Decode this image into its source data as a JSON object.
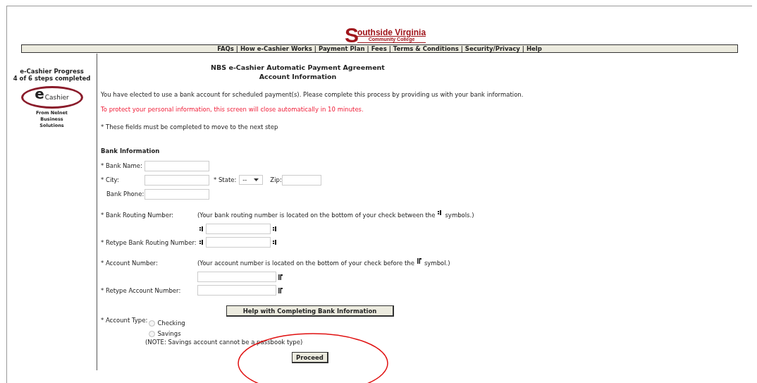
{
  "logo": {
    "initial": "S",
    "name": "outhside Virginia",
    "subtitle": "Community College"
  },
  "nav": {
    "separator": "|",
    "links": [
      "FAQs",
      "How e-Cashier Works",
      "Payment Plan",
      "Fees",
      "Terms & Conditions",
      "Security/Privacy",
      "Help"
    ]
  },
  "sidebar": {
    "progress_title": "e-Cashier Progress",
    "progress_steps": "4 of 6 steps completed",
    "badge_letter": "e",
    "badge_word": "Cashier",
    "badge_caption": "From Nelnet Business Solutions"
  },
  "heading": [
    "NBS e-Cashier Automatic Payment Agreement",
    "Account Information"
  ],
  "intro": "You have elected to use a bank account for scheduled payment(s). Please complete this process by providing us with your bank information.",
  "warning": "To protect your personal information, this screen will close automatically in 10 minutes.",
  "required_note": "* These fields must be completed to move to the next step",
  "section_title": "Bank Information",
  "fields": {
    "bank_name": "* Bank Name:",
    "city": "* City:",
    "state": "* State:",
    "state_value": "--",
    "zip": "Zip:",
    "bank_phone": "Bank Phone:",
    "routing": "* Bank Routing Number:",
    "routing_hint_start": "(Your bank routing number is located on the bottom of your check between the",
    "routing_hint_end": "symbols.)",
    "retype_routing": "* Retype Bank Routing Number:",
    "account": "* Account Number:",
    "account_hint_start": "(Your account number is located on the bottom of your check before the",
    "account_hint_end": "symbol.)",
    "retype_account": "* Retype Account Number:"
  },
  "help_button": "Help with Completing Bank Information",
  "account_type": {
    "label": "* Account Type:",
    "options": [
      {
        "label": "Checking",
        "selected": false
      },
      {
        "label": "Savings",
        "selected": false
      }
    ],
    "note": "(NOTE: Savings account cannot be a passbook type)"
  },
  "proceed_button": "Proceed"
}
